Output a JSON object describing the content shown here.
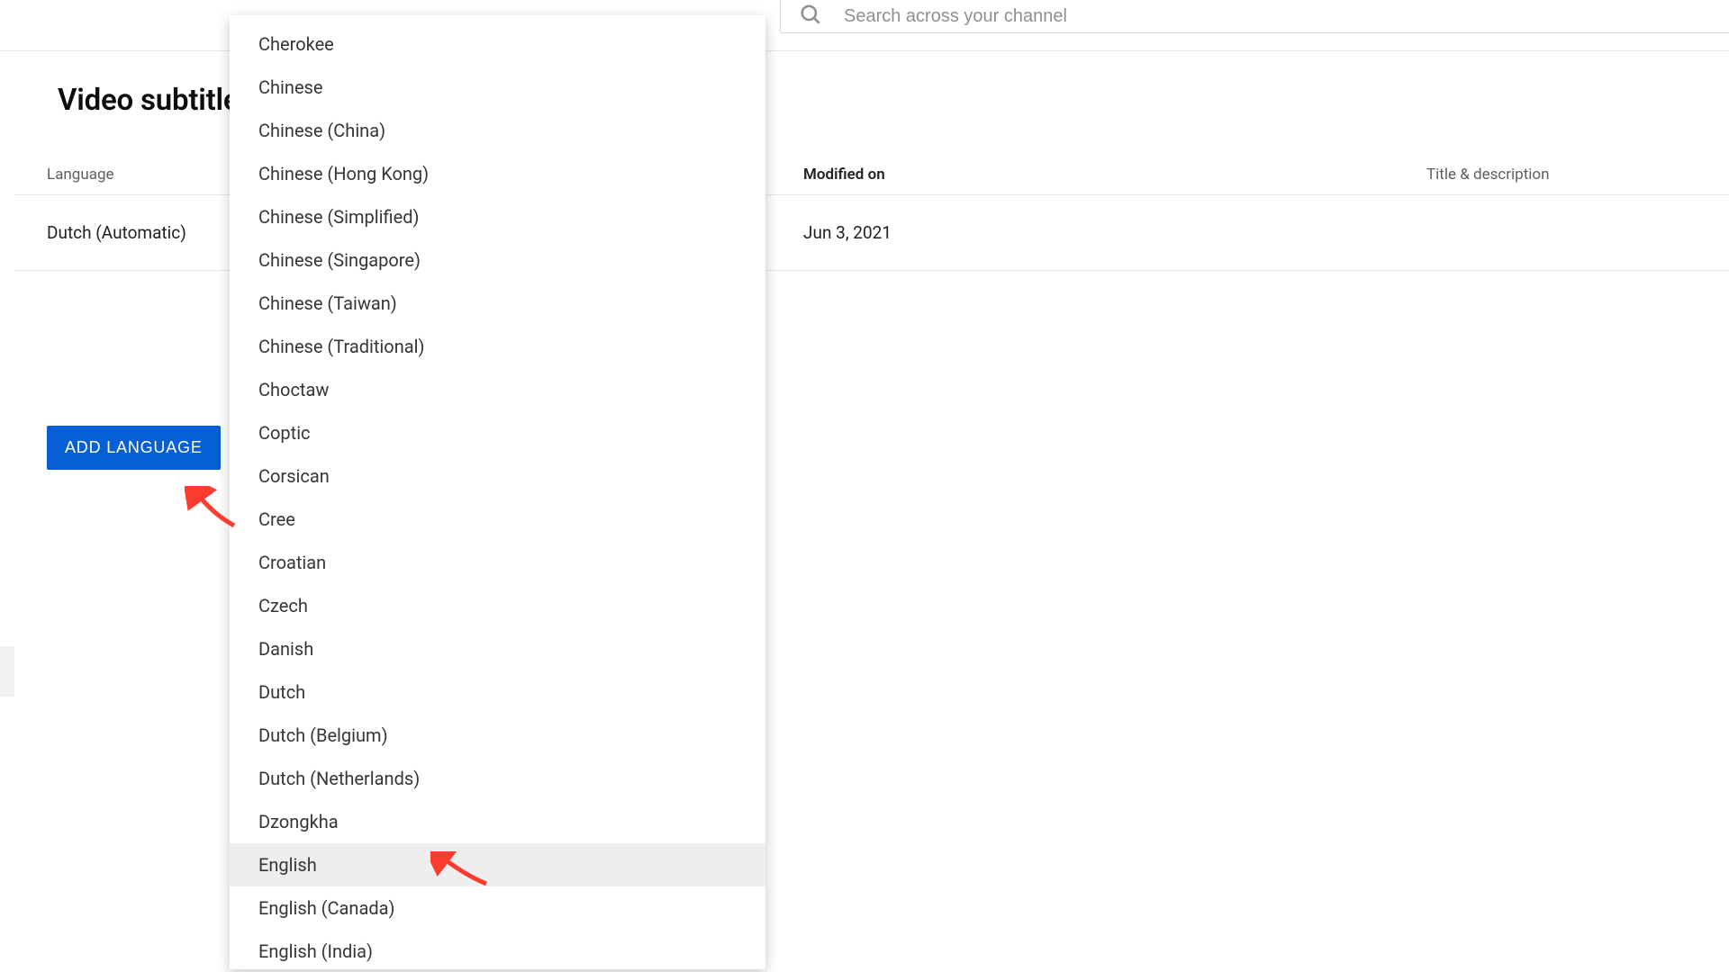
{
  "header": {
    "search_placeholder": "Search across your channel"
  },
  "page": {
    "title": "Video subtitles"
  },
  "columns": {
    "language": "Language",
    "modified": "Modified on",
    "title_desc": "Title & description"
  },
  "rows": [
    {
      "language": "Dutch (Automatic)",
      "modified": "Jun 3, 2021",
      "title_desc": ""
    }
  ],
  "add_language_label": "ADD LANGUAGE",
  "languages": [
    "Cherokee",
    "Chinese",
    "Chinese (China)",
    "Chinese (Hong Kong)",
    "Chinese (Simplified)",
    "Chinese (Singapore)",
    "Chinese (Taiwan)",
    "Chinese (Traditional)",
    "Choctaw",
    "Coptic",
    "Corsican",
    "Cree",
    "Croatian",
    "Czech",
    "Danish",
    "Dutch",
    "Dutch (Belgium)",
    "Dutch (Netherlands)",
    "Dzongkha",
    "English",
    "English (Canada)",
    "English (India)"
  ],
  "hovered_language_index": 19,
  "colors": {
    "accent": "#065fd4",
    "arrow": "#fd3b2f"
  }
}
